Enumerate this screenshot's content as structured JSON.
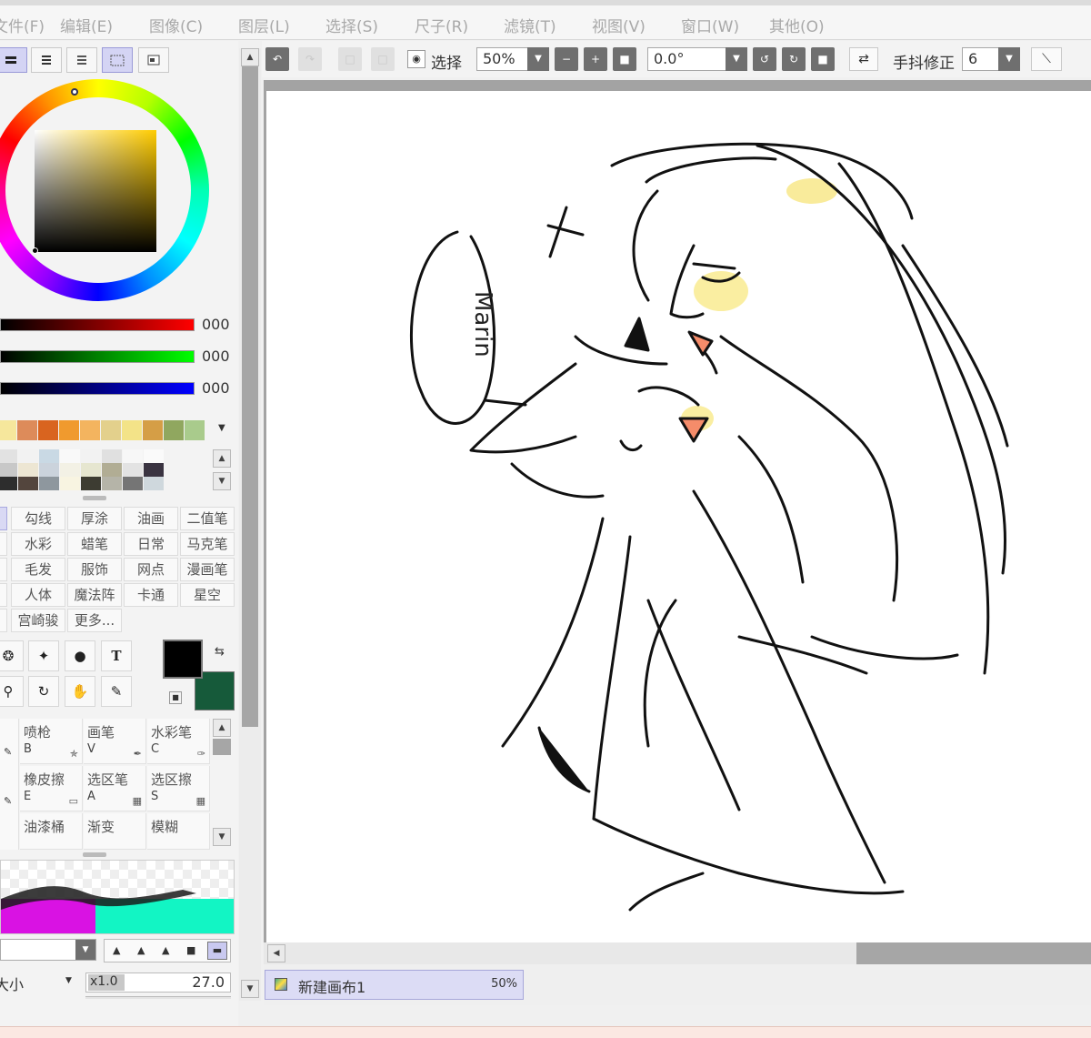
{
  "menu": [
    "文件(F)",
    "编辑(E)",
    "图像(C)",
    "图层(L)",
    "选择(S)",
    "尺子(R)",
    "滤镜(T)",
    "视图(V)",
    "窗口(W)",
    "其他(O)"
  ],
  "toolbar": {
    "select_label": "选择",
    "zoom_value": "50%",
    "angle_value": "0.0°",
    "stabilizer_label": "手抖修正",
    "stabilizer_value": "6"
  },
  "color": {
    "r_value": "000",
    "g_value": "000",
    "b_value": "000",
    "primary": "#000000",
    "secondary": "#165a3a"
  },
  "swatches_row": [
    "#f6e79c",
    "#dd8b5a",
    "#d9641f",
    "#f09a2e",
    "#f3b45f",
    "#e3d08c",
    "#f3e388",
    "#d59e46",
    "#90a75f",
    "#a9cb8c"
  ],
  "swatch_grid": [
    [
      "#e2e2e2",
      "#f2f2f2",
      "#c9d9e4",
      "#f9f9f9",
      "#f2f2f2",
      "#e0e0e0",
      "#f7f7f7",
      "#fafafa"
    ],
    [
      "#c8c8c8",
      "#ede6d3",
      "#cbd3dc",
      "#f3f1e5",
      "#e6e6d0",
      "#b1ad94",
      "#e3e3e3",
      "#3a3441"
    ],
    [
      "#2d2d2d",
      "#53453d",
      "#8e979e",
      "#f8f4e1",
      "#3d3c32",
      "#b5b4a8",
      "#757575",
      "#cfd8dd"
    ]
  ],
  "brushes": [
    [
      "勾线",
      "厚涂",
      "油画",
      "二值笔"
    ],
    [
      "水彩",
      "蜡笔",
      "日常",
      "马克笔"
    ],
    [
      "毛发",
      "服饰",
      "网点",
      "漫画笔"
    ],
    [
      "人体",
      "魔法阵",
      "卡通",
      "星空"
    ],
    [
      "宫崎骏",
      "更多..."
    ]
  ],
  "tools": [
    {
      "name": "喷枪",
      "key": "B"
    },
    {
      "name": "画笔",
      "key": "V"
    },
    {
      "name": "水彩笔",
      "key": "C"
    },
    {
      "name": "橡皮擦",
      "key": "E"
    },
    {
      "name": "选区笔",
      "key": "A"
    },
    {
      "name": "选区擦",
      "key": "S"
    },
    {
      "name": "油漆桶",
      "key": ""
    },
    {
      "name": "渐变",
      "key": ""
    },
    {
      "name": "模糊",
      "key": ""
    }
  ],
  "brush_size": {
    "label": "大小",
    "multiplier": "x1.0",
    "value": "27.0"
  },
  "canvas_text": "Marin",
  "document": {
    "tab_name": "新建画布1",
    "zoom": "50%"
  }
}
